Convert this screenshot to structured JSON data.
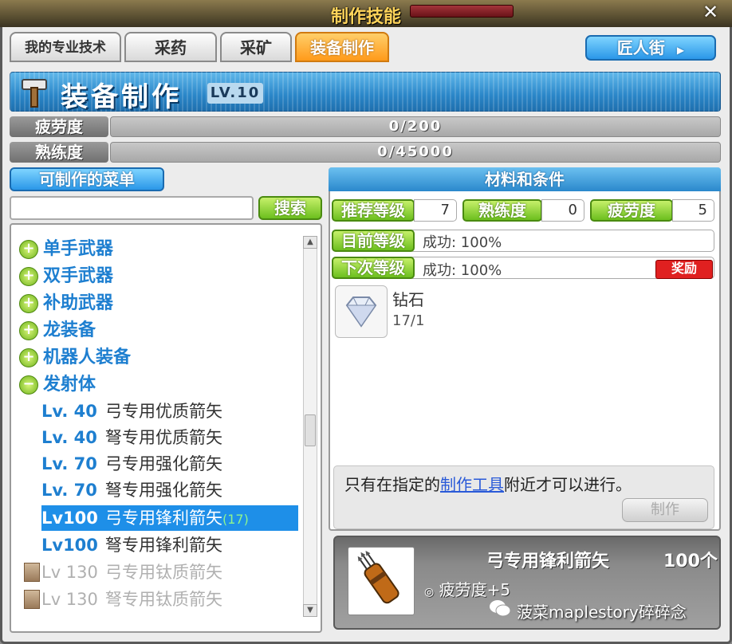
{
  "window": {
    "title": "制作技能",
    "close": "✕"
  },
  "tabs": [
    {
      "label": "我的专业技术"
    },
    {
      "label": "采药"
    },
    {
      "label": "采矿"
    },
    {
      "label": "装备制作"
    }
  ],
  "craftsman_button": "匠人街",
  "header": {
    "title": "装备制作",
    "level": "LV.10"
  },
  "stats": {
    "fatigue_label": "疲劳度",
    "fatigue_value": "0/200",
    "mastery_label": "熟练度",
    "mastery_value": "0/45000"
  },
  "left": {
    "recipes_button": "可制作的菜单",
    "search_placeholder": "",
    "search_button": "搜索",
    "categories": [
      {
        "icon": "+",
        "label": "单手武器"
      },
      {
        "icon": "+",
        "label": "双手武器"
      },
      {
        "icon": "+",
        "label": "补助武器"
      },
      {
        "icon": "+",
        "label": "龙装备"
      },
      {
        "icon": "+",
        "label": "机器人装备"
      },
      {
        "icon": "−",
        "label": "发射体"
      }
    ],
    "items": [
      {
        "level": "Lv. 40",
        "name": "弓专用优质箭矢",
        "count": ""
      },
      {
        "level": "Lv. 40",
        "name": "弩专用优质箭矢",
        "count": ""
      },
      {
        "level": "Lv. 70",
        "name": "弓专用强化箭矢",
        "count": ""
      },
      {
        "level": "Lv. 70",
        "name": "弩专用强化箭矢",
        "count": ""
      },
      {
        "level": "Lv100",
        "name": "弓专用锋利箭矢",
        "count": "(17)"
      },
      {
        "level": "Lv100",
        "name": "弩专用锋利箭矢",
        "count": ""
      },
      {
        "level": "Lv 130",
        "name": "弓专用钛质箭矢",
        "count": ""
      },
      {
        "level": "Lv 130",
        "name": "弩专用钛质箭矢",
        "count": ""
      }
    ]
  },
  "right": {
    "header": "材料和条件",
    "req_level_label": "推荐等级",
    "req_level_value": "7",
    "req_mastery_label": "熟练度",
    "req_mastery_value": "0",
    "req_fatigue_label": "疲劳度",
    "req_fatigue_value": "5",
    "current_label": "目前等级",
    "current_text": "成功: 100%",
    "next_label": "下次等级",
    "next_text": "成功: 100%",
    "reward_badge": "奖励",
    "material_name": "钻石",
    "material_count": "17/1",
    "note_prefix": "只有在指定的",
    "note_link": "制作工具",
    "note_suffix": "附近才可以进行。",
    "make_button": "制作"
  },
  "result": {
    "name": "弓专用锋利箭矢",
    "count": "100个",
    "fatigue": "疲劳度+5",
    "watermark": "菠菜maplestory碎碎念"
  },
  "colors": {
    "accent_blue": "#2a88cc",
    "tab_active": "#ff9a1a",
    "green": "#6cbf1e",
    "selected_row": "#1e8fe8"
  }
}
